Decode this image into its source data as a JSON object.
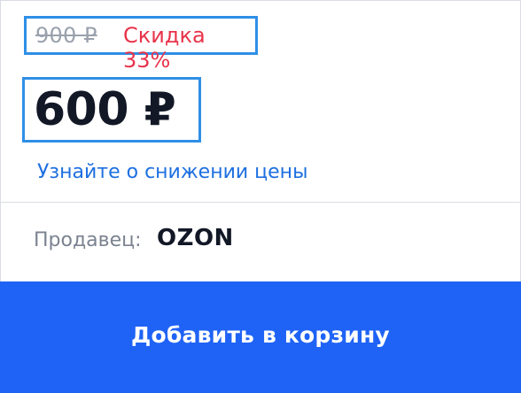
{
  "pricing": {
    "old_price": "900 ₽",
    "discount": "Скидка 33%",
    "current_price": "600 ₽",
    "price_drop_link": "Узнайте о снижении цены"
  },
  "seller": {
    "label": "Продавец:",
    "name": "OZON"
  },
  "actions": {
    "add_to_cart": "Добавить в корзину"
  },
  "colors": {
    "highlight_border": "#2f8fe6",
    "discount": "#e8334a",
    "link": "#1d6fe0",
    "button": "#1f63f6"
  }
}
